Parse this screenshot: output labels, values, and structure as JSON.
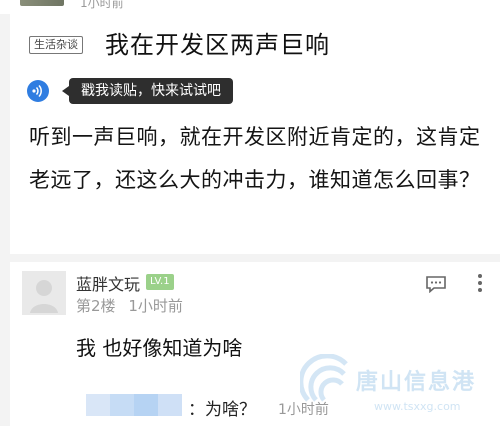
{
  "top_user": {
    "time": "1小时前"
  },
  "post": {
    "category": "生活杂谈",
    "title": "我在开发区两声巨响",
    "read_tooltip": "戳我读贴，快来试试吧",
    "body": "听到一声巨响，就在开发区附近肯定的，这肯定老远了，还这么大的冲击力，谁知道怎么回事？"
  },
  "comment": {
    "username": "蓝胖文玩",
    "level": "LV.1",
    "floor": "第2楼",
    "time": "1小时前",
    "text": "我 也好像知道为啥",
    "reply": {
      "text": "：为啥？",
      "time": "1小时前"
    }
  },
  "watermark": {
    "text": "唐山信息港",
    "url": "www.tsxxg.com"
  },
  "colors": {
    "background": "#f3f3f3",
    "card": "#ffffff",
    "accent_blue": "#2f7de1",
    "level_badge": "#9bd18a",
    "tooltip_bg": "#2e2e2e"
  },
  "icons": {
    "read": "voice-read-icon",
    "reply": "comment-bubble-icon",
    "more": "more-vertical-icon",
    "avatar": "default-avatar-icon"
  }
}
